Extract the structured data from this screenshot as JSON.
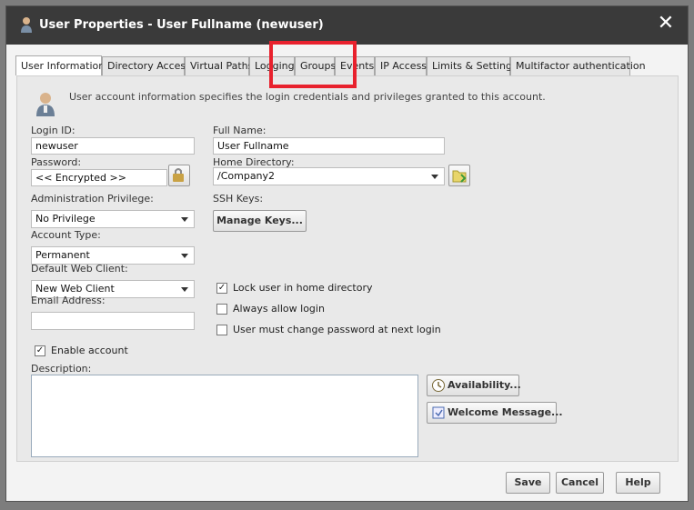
{
  "window": {
    "title": "User Properties - User Fullname (newuser)",
    "close_glyph": "✕"
  },
  "tabs": [
    {
      "label": "User Information",
      "active": true
    },
    {
      "label": "Directory Access"
    },
    {
      "label": "Virtual Paths"
    },
    {
      "label": "Logging"
    },
    {
      "label": "Groups"
    },
    {
      "label": "Events"
    },
    {
      "label": "IP Access"
    },
    {
      "label": "Limits & Settings"
    },
    {
      "label": "Multifactor authentication"
    }
  ],
  "info_text": "User account information specifies the login credentials and privileges granted to this account.",
  "form": {
    "login_id_label": "Login ID:",
    "login_id_value": "newuser",
    "full_name_label": "Full Name:",
    "full_name_value": "User Fullname",
    "password_label": "Password:",
    "password_value": "<< Encrypted >>",
    "home_dir_label": "Home Directory:",
    "home_dir_value": "/Company2",
    "admin_priv_label": "Administration Privilege:",
    "admin_priv_value": "No Privilege",
    "ssh_keys_label": "SSH Keys:",
    "manage_keys_button": "Manage Keys...",
    "account_type_label": "Account Type:",
    "account_type_value": "Permanent",
    "web_client_label": "Default Web Client:",
    "web_client_value": "New Web Client",
    "email_label": "Email Address:",
    "email_value": "",
    "lock_home_label": "Lock user in home directory",
    "lock_home_checked": true,
    "always_allow_label": "Always allow login",
    "always_allow_checked": false,
    "must_change_label": "User must change password at next login",
    "must_change_checked": false,
    "enable_account_label": "Enable account",
    "enable_account_checked": true,
    "description_label": "Description:",
    "description_value": "",
    "availability_button": "Availability...",
    "welcome_button": "Welcome Message..."
  },
  "footer": {
    "save": "Save",
    "cancel": "Cancel",
    "help": "Help"
  },
  "colors": {
    "titlebar": "#3a3a3a",
    "highlight": "#e8212d"
  },
  "icons": [
    "user-icon",
    "close-icon",
    "user-info-icon",
    "key-edit-icon",
    "folder-browse-icon",
    "clock-icon",
    "welcome-message-icon",
    "chevron-down-icon"
  ]
}
